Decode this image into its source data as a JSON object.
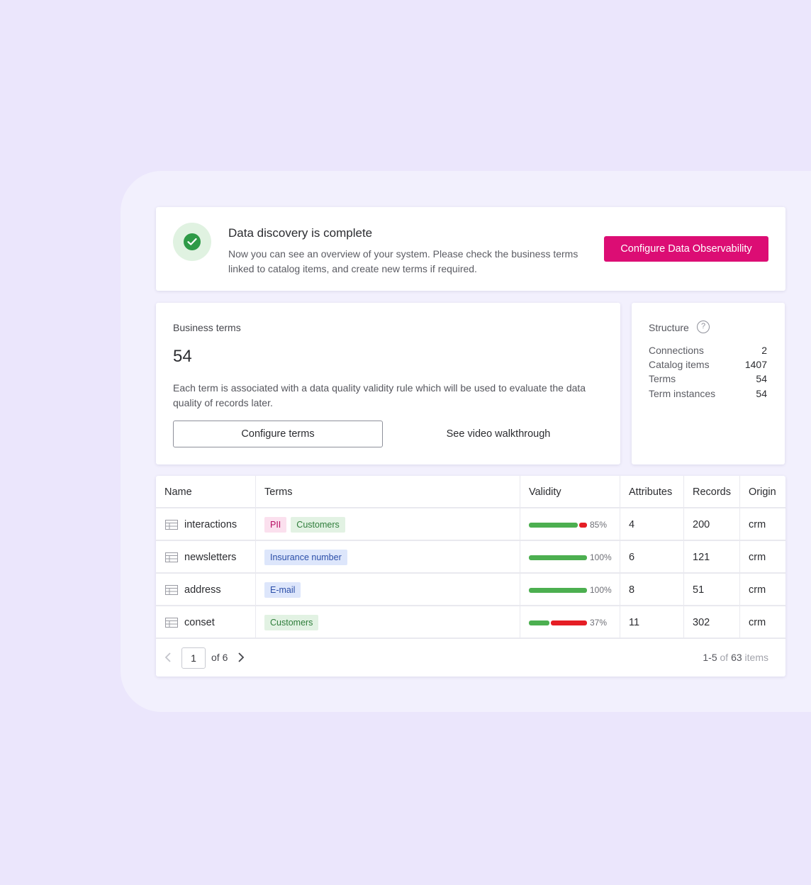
{
  "banner": {
    "title": "Data discovery is complete",
    "description": "Now you can see an overview of your system. Please check the business terms linked to catalog items, and create new terms if required.",
    "button_label": "Configure Data Observability",
    "icon": "check-circle-icon"
  },
  "business_terms": {
    "label": "Business terms",
    "count": "54",
    "description": "Each term is associated with a data quality validity rule which will be used to evaluate the data quality of records later.",
    "configure_label": "Configure terms",
    "video_label": "See video walkthrough"
  },
  "structure": {
    "title": "Structure",
    "help_icon": "question-circle-icon",
    "stats": [
      {
        "label": "Connections",
        "value": "2"
      },
      {
        "label": "Catalog items",
        "value": "1407"
      },
      {
        "label": "Terms",
        "value": "54"
      },
      {
        "label": "Term instances",
        "value": "54"
      }
    ]
  },
  "table": {
    "headers": {
      "name": "Name",
      "terms": "Terms",
      "validity": "Validity",
      "attributes": "Attributes",
      "records": "Records",
      "origin": "Origin"
    },
    "rows": [
      {
        "name": "interactions",
        "terms": [
          {
            "label": "PII",
            "color": "pink"
          },
          {
            "label": "Customers",
            "color": "green"
          }
        ],
        "validity": 0.85,
        "validity_label": "85%",
        "attributes": "4",
        "records": "200",
        "origin": "crm"
      },
      {
        "name": "newsletters",
        "terms": [
          {
            "label": "Insurance number",
            "color": "blue"
          }
        ],
        "validity": 1.0,
        "validity_label": "100%",
        "attributes": "6",
        "records": "121",
        "origin": "crm"
      },
      {
        "name": "address",
        "terms": [
          {
            "label": "E-mail",
            "color": "blue"
          }
        ],
        "validity": 1.0,
        "validity_label": "100%",
        "attributes": "8",
        "records": "51",
        "origin": "crm"
      },
      {
        "name": "conset",
        "terms": [
          {
            "label": "Customers",
            "color": "green"
          }
        ],
        "validity": 0.37,
        "validity_label": "37%",
        "attributes": "11",
        "records": "302",
        "origin": "crm"
      }
    ],
    "pagination": {
      "current_page": "1",
      "of_label": "of 6",
      "range": "1-5",
      "of_word": "of",
      "total": "63",
      "items_word": "items"
    }
  },
  "colors": {
    "background": "#ebe6fc",
    "accent": "#dc0d74",
    "success": "#2e9a47",
    "valid_bar": "#4caf50",
    "invalid_bar": "#e51e25"
  }
}
